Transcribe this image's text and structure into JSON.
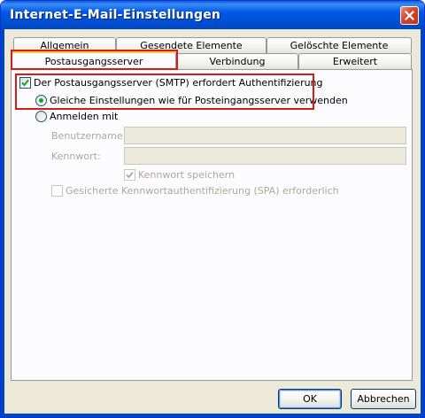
{
  "window": {
    "title": "Internet-E-Mail-Einstellungen",
    "close_icon": "close-icon"
  },
  "tabs": {
    "row_back": [
      "Allgemein",
      "Gesendete Elemente",
      "Gelöschte Elemente"
    ],
    "row_front": [
      "Postausgangsserver",
      "Verbindung",
      "Erweitert"
    ],
    "active": "Postausgangsserver"
  },
  "smtp_auth": {
    "checkbox_label": "Der Postausgangsserver (SMTP) erfordert Authentifizierung",
    "checked": true,
    "option_same": "Gleiche Einstellungen wie für Posteingangsserver verwenden",
    "option_login": "Anmelden mit",
    "selected": "option_same"
  },
  "login": {
    "username_label": "Benutzername:",
    "username_value": "",
    "password_label": "Kennwort:",
    "password_value": "",
    "save_password_label": "Kennwort speichern",
    "save_password_checked": true,
    "spa_label": "Gesicherte Kennwortauthentifizierung (SPA) erforderlich",
    "spa_checked": false
  },
  "buttons": {
    "ok": "OK",
    "cancel": "Abbrechen"
  },
  "colors": {
    "titlebar": "#0058e6",
    "highlight": "#d61b1b",
    "tab_accent": "#ffc83c",
    "radio_dot": "#21a121"
  }
}
